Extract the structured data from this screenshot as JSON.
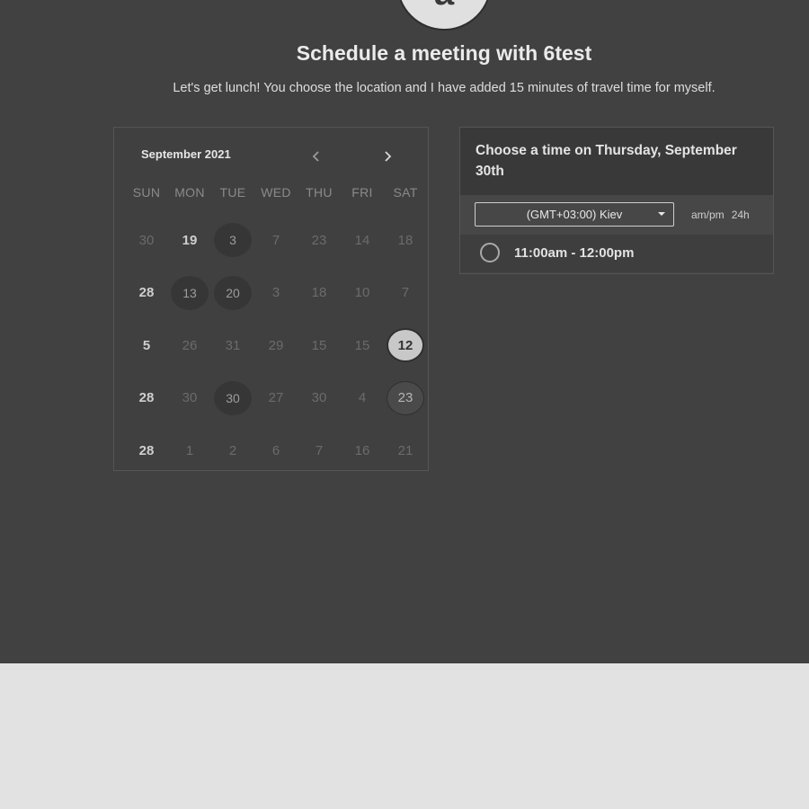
{
  "header": {
    "avatar_initial": "a",
    "title": "Schedule a meeting with 6test",
    "subtitle": "Let's get lunch! You choose the location and I have added 15 minutes of travel time for myself."
  },
  "calendar": {
    "month_label": "September 2021",
    "prev_icon": "chevron-left-icon",
    "next_icon": "chevron-right-icon",
    "weekdays": [
      "SUN",
      "MON",
      "TUE",
      "WED",
      "THU",
      "FRI",
      "SAT"
    ],
    "weeks": [
      [
        {
          "label": "30",
          "state": "muted"
        },
        {
          "label": "19",
          "state": "bold"
        },
        {
          "label": "3",
          "state": "avail"
        },
        {
          "label": "7",
          "state": "muted"
        },
        {
          "label": "23",
          "state": "muted"
        },
        {
          "label": "14",
          "state": "muted"
        },
        {
          "label": "18",
          "state": "muted"
        }
      ],
      [
        {
          "label": "28",
          "state": "bold"
        },
        {
          "label": "13",
          "state": "avail"
        },
        {
          "label": "20",
          "state": "avail"
        },
        {
          "label": "3",
          "state": "muted"
        },
        {
          "label": "18",
          "state": "muted"
        },
        {
          "label": "10",
          "state": "muted"
        },
        {
          "label": "7",
          "state": "muted"
        }
      ],
      [
        {
          "label": "5",
          "state": "bold"
        },
        {
          "label": "26",
          "state": "muted"
        },
        {
          "label": "31",
          "state": "muted"
        },
        {
          "label": "29",
          "state": "muted"
        },
        {
          "label": "15",
          "state": "muted"
        },
        {
          "label": "15",
          "state": "muted"
        },
        {
          "label": "12",
          "state": "selected"
        }
      ],
      [
        {
          "label": "28",
          "state": "bold"
        },
        {
          "label": "30",
          "state": "muted"
        },
        {
          "label": "30",
          "state": "avail"
        },
        {
          "label": "27",
          "state": "muted"
        },
        {
          "label": "30",
          "state": "muted"
        },
        {
          "label": "4",
          "state": "muted"
        },
        {
          "label": "23",
          "state": "avail-light"
        }
      ],
      [
        {
          "label": "28",
          "state": "bold"
        },
        {
          "label": "1",
          "state": "muted"
        },
        {
          "label": "2",
          "state": "muted"
        },
        {
          "label": "6",
          "state": "muted"
        },
        {
          "label": "7",
          "state": "muted"
        },
        {
          "label": "16",
          "state": "muted"
        },
        {
          "label": "21",
          "state": "muted"
        }
      ]
    ]
  },
  "time_panel": {
    "heading": "Choose a time on Thursday, September 30th",
    "timezone_value": "(GMT+03:00) Kiev",
    "format_ampm": "am/pm",
    "format_24h": "24h",
    "slots": [
      {
        "label": "11:00am - 12:00pm"
      }
    ]
  }
}
